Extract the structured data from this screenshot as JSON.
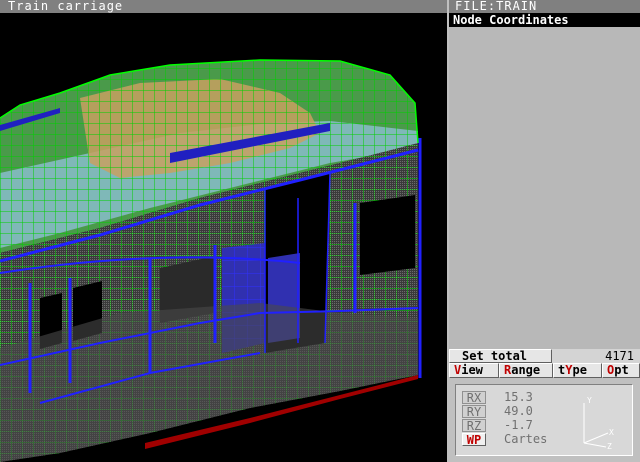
{
  "window": {
    "title": "Train carriage"
  },
  "file": {
    "label": "FILE:TRAIN"
  },
  "panel": {
    "title": "Node Coordinates"
  },
  "set_total": {
    "label": "Set total",
    "value": "4171"
  },
  "menu": {
    "items": [
      {
        "pre": "",
        "hot": "V",
        "post": "iew"
      },
      {
        "pre": "",
        "hot": "R",
        "post": "ange"
      },
      {
        "pre": "t",
        "hot": "Y",
        "post": "pe"
      },
      {
        "pre": "",
        "hot": "O",
        "post": "pt"
      }
    ]
  },
  "coords": {
    "rx_label": "RX",
    "rx_value": "15.3",
    "ry_label": "RY",
    "ry_value": "49.0",
    "rz_label": "RZ",
    "rz_value": "-1.7",
    "wp_label": "WP",
    "wp_mode": "Cartes"
  },
  "triad": {
    "y": "Y",
    "x": "X",
    "z": "Z"
  },
  "colors": {
    "mesh_green": "#00ff00",
    "mesh_blue": "#0000ff",
    "wall_grey": "#505050",
    "roof_cyan": "#7fc8c8",
    "roof_tan": "#c8a060",
    "floor_red": "#a00000"
  }
}
